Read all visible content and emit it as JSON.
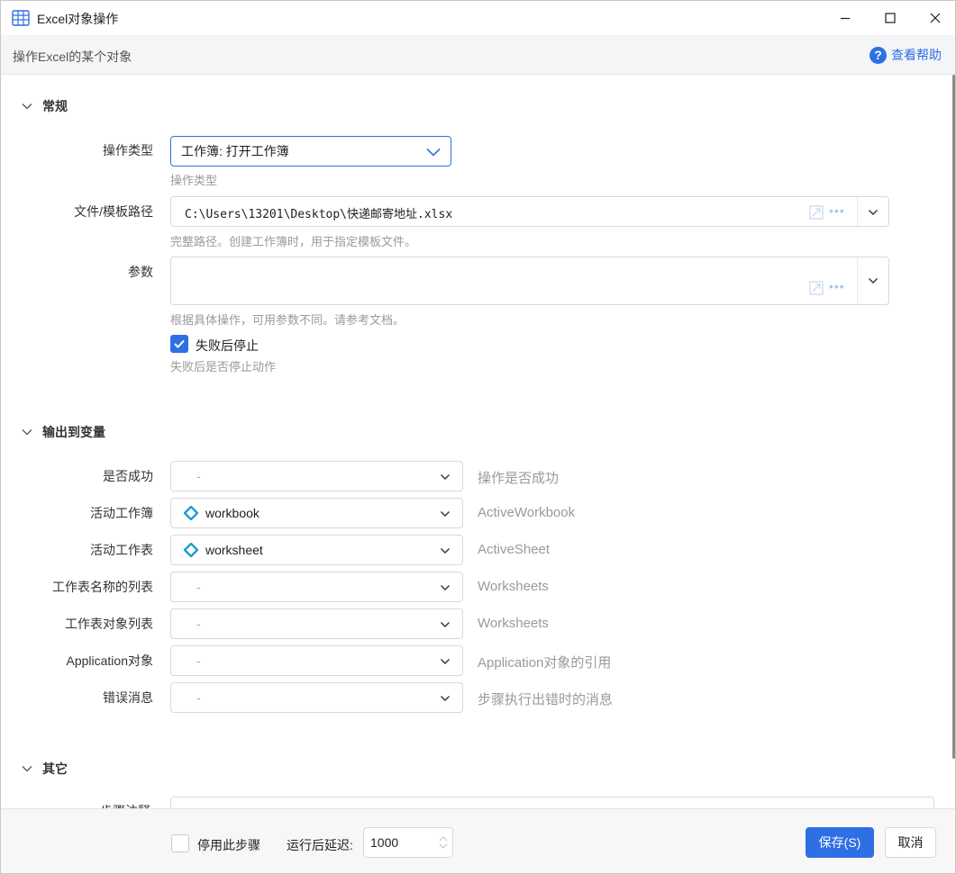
{
  "window": {
    "title": "Excel对象操作",
    "description": "操作Excel的某个对象",
    "help_label": "查看帮助"
  },
  "general": {
    "section_title": "常规",
    "op_type": {
      "label": "操作类型",
      "value": "工作簿: 打开工作簿",
      "hint": "操作类型"
    },
    "file_path": {
      "label": "文件/模板路径",
      "value": "C:\\Users\\13201\\Desktop\\快递邮寄地址.xlsx",
      "hint": "完整路径。创建工作簿时，用于指定模板文件。"
    },
    "params": {
      "label": "参数",
      "value": "",
      "hint": "根据具体操作，可用参数不同。请参考文档。"
    },
    "stop_on_fail": {
      "label": "失败后停止",
      "checked": true,
      "hint": "失败后是否停止动作"
    },
    "more_glyph": "•••"
  },
  "output": {
    "section_title": "输出到变量",
    "rows": [
      {
        "label": "是否成功",
        "value": "-",
        "has_var": false,
        "desc": "操作是否成功"
      },
      {
        "label": "活动工作簿",
        "value": "workbook",
        "has_var": true,
        "desc": "ActiveWorkbook"
      },
      {
        "label": "活动工作表",
        "value": "worksheet",
        "has_var": true,
        "desc": "ActiveSheet"
      },
      {
        "label": "工作表名称的列表",
        "value": "-",
        "has_var": false,
        "desc": "Worksheets"
      },
      {
        "label": "工作表对象列表",
        "value": "-",
        "has_var": false,
        "desc": "Worksheets"
      },
      {
        "label": "Application对象",
        "value": "-",
        "has_var": false,
        "desc": "Application对象的引用"
      },
      {
        "label": "错误消息",
        "value": "-",
        "has_var": false,
        "desc": "步骤执行出错时的消息"
      }
    ]
  },
  "other": {
    "section_title": "其它",
    "partial_label": "步骤注释"
  },
  "footer": {
    "disable_label": "停用此步骤",
    "disable_checked": false,
    "delay_label": "运行后延迟:",
    "delay_value": "1000",
    "save_label": "保存(S)",
    "cancel_label": "取消"
  },
  "colors": {
    "accent": "#2f6fe4",
    "var_icon": "#1e9bd7"
  }
}
